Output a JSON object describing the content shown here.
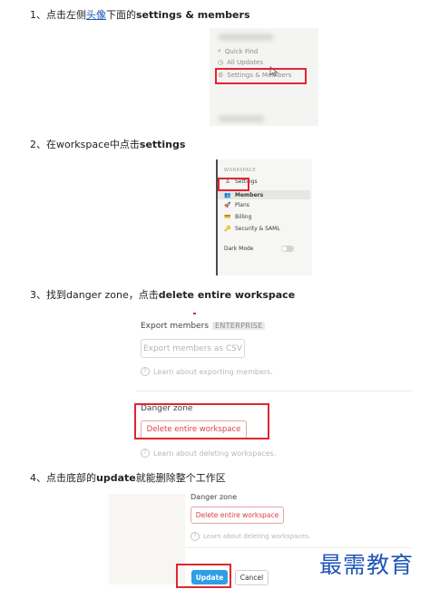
{
  "steps": [
    {
      "prefix": "1、点击左侧",
      "link": "头像",
      "middle": "下面的",
      "bold": "settings & members"
    },
    {
      "prefix": "2、在workspace中点击",
      "bold": "settings"
    },
    {
      "prefix": "3、找到danger zone，点击",
      "bold": "delete entire workspace"
    },
    {
      "prefix": "4、点击底部的",
      "bold": "update",
      "suffix": "就能删除整个工作区"
    }
  ],
  "shot1": {
    "items": [
      {
        "icon": "search-icon",
        "glyph": "⌕",
        "label": "Quick Find"
      },
      {
        "icon": "clock-icon",
        "glyph": "◷",
        "label": "All Updates"
      },
      {
        "icon": "gear-icon",
        "glyph": "⚙",
        "label": "Settings & Members"
      }
    ]
  },
  "shot2": {
    "header": "WORKSPACE",
    "items": [
      {
        "icon": "settings-person-icon",
        "glyph": "♙",
        "label": "Settings",
        "active": false
      },
      {
        "icon": "members-icon",
        "glyph": "👥",
        "label": "Members",
        "active": true
      },
      {
        "icon": "rocket-icon",
        "glyph": "🚀",
        "label": "Plans",
        "active": false
      },
      {
        "icon": "card-icon",
        "glyph": "💳",
        "label": "Billing",
        "active": false
      },
      {
        "icon": "key-icon",
        "glyph": "🔑",
        "label": "Security & SAML",
        "active": false
      }
    ],
    "dark_mode": "Dark Mode"
  },
  "shot3": {
    "export_label": "Export members",
    "export_badge": "ENTERPRISE",
    "export_button": "Export members as CSV",
    "export_help": "Learn about exporting members.",
    "danger_label": "Danger zone",
    "delete_button": "Delete entire workspace",
    "delete_help": "Learn about deleting workspaces."
  },
  "shot4": {
    "danger_label": "Danger zone",
    "delete_button": "Delete entire workspace",
    "delete_help": "Learn about deleting workspaces.",
    "update_button": "Update",
    "cancel_button": "Cancel"
  },
  "watermark": "最需教育",
  "colors": {
    "highlight": "#e0262f",
    "link": "#1a58b6",
    "primary": "#2f9ee4",
    "danger": "#d7404a"
  }
}
